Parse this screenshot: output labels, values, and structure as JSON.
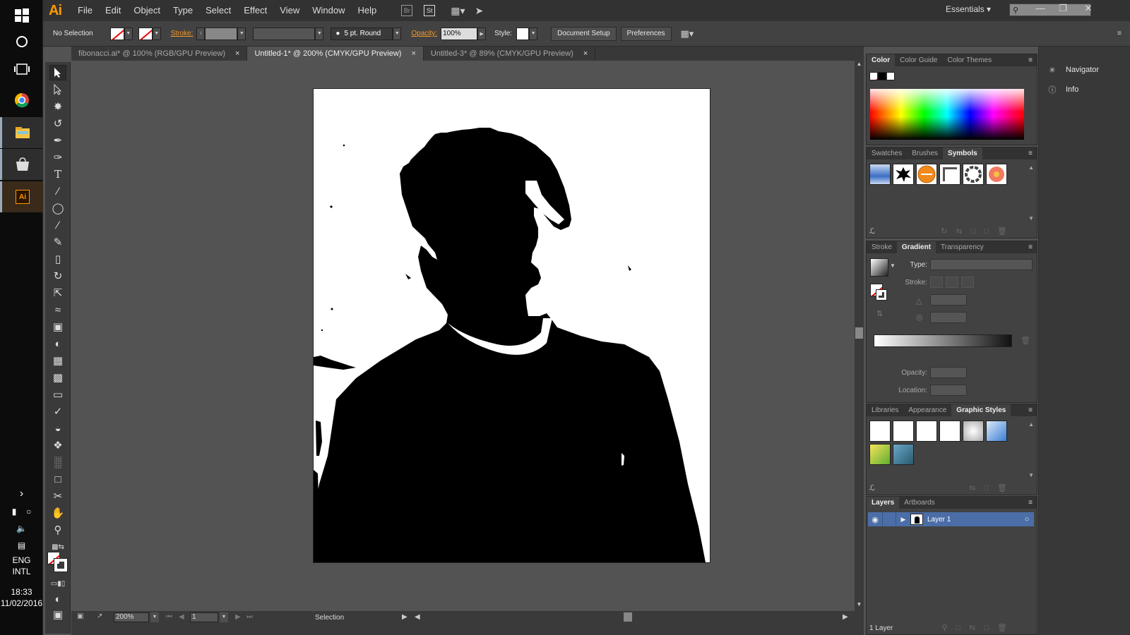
{
  "taskbar": {
    "language": "ENG",
    "layout": "INTL",
    "time": "18:33",
    "date": "11/02/2016",
    "apps": [
      "windows-logo-icon",
      "cortana-icon",
      "task-view-icon",
      "chrome-icon",
      "file-explorer-icon",
      "store-icon",
      "illustrator-icon"
    ]
  },
  "menubar": {
    "logo": "Ai",
    "items": [
      "File",
      "Edit",
      "Object",
      "Type",
      "Select",
      "Effect",
      "View",
      "Window",
      "Help"
    ],
    "bridge_label": "Br",
    "stock_label": "St",
    "workspace": "Essentials",
    "search_placeholder": ""
  },
  "controlbar": {
    "selection": "No Selection",
    "stroke_label": "Stroke:",
    "brush": "5 pt. Round",
    "opacity_label": "Opacity:",
    "opacity_value": "100%",
    "style_label": "Style:",
    "document_setup": "Document Setup",
    "preferences": "Preferences"
  },
  "tabs": [
    {
      "label": "fibonacci.ai* @ 100% (RGB/GPU Preview)",
      "active": false
    },
    {
      "label": "Untitled-1* @ 200% (CMYK/GPU Preview)",
      "active": true
    },
    {
      "label": "Untitled-3* @ 89% (CMYK/GPU Preview)",
      "active": false
    }
  ],
  "tools": [
    "selection-tool",
    "direct-selection-tool",
    "magic-wand-tool",
    "lasso-tool",
    "pen-tool",
    "curvature-tool",
    "type-tool",
    "line-tool",
    "ellipse-tool",
    "paintbrush-tool",
    "pencil-tool",
    "eraser-tool",
    "rotate-tool",
    "scale-tool",
    "warp-tool",
    "free-transform-tool",
    "shape-builder-tool",
    "perspective-grid-tool",
    "mesh-tool",
    "gradient-tool",
    "eyedropper-tool",
    "blend-tool",
    "symbol-sprayer-tool",
    "column-graph-tool",
    "artboard-tool",
    "slice-tool",
    "hand-tool",
    "zoom-tool"
  ],
  "status": {
    "zoom": "200%",
    "artboard_number": "1",
    "tool_name": "Selection"
  },
  "color_panel": {
    "tabs": [
      "Color",
      "Color Guide",
      "Color Themes"
    ]
  },
  "symbols_panel": {
    "tabs": [
      "Swatches",
      "Brushes",
      "Symbols"
    ]
  },
  "gradient_panel": {
    "tabs": [
      "Stroke",
      "Gradient",
      "Transparency"
    ],
    "type_label": "Type:",
    "stroke_label": "Stroke:",
    "opacity_label": "Opacity:",
    "location_label": "Location:"
  },
  "styles_panel": {
    "tabs": [
      "Libraries",
      "Appearance",
      "Graphic Styles"
    ]
  },
  "layers_panel": {
    "tabs": [
      "Layers",
      "Artboards"
    ],
    "layer_name": "Layer 1",
    "footer": "1 Layer"
  },
  "right_dock": {
    "items": [
      "Navigator",
      "Info"
    ]
  },
  "colors": {
    "accent_orange": "#ff9a00",
    "link_orange": "#f29a2e",
    "layer_highlight": "#4b6ea8"
  }
}
